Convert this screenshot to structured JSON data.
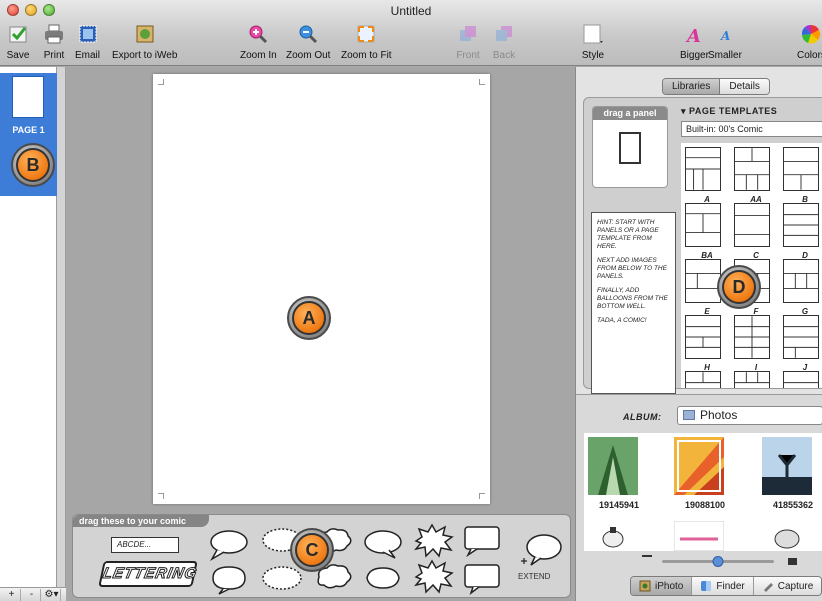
{
  "window": {
    "title": "Untitled"
  },
  "toolbar": {
    "save": "Save",
    "print": "Print",
    "email": "Email",
    "export": "Export to iWeb",
    "zoom_in": "Zoom In",
    "zoom_out": "Zoom Out",
    "zoom_fit": "Zoom to Fit",
    "front": "Front",
    "back": "Back",
    "style": "Style",
    "bigger": "Bigger",
    "smaller": "Smaller",
    "colors": "Colors"
  },
  "pages": {
    "items": [
      {
        "label": "PAGE 1"
      }
    ],
    "footer": {
      "add": "+",
      "remove": "-",
      "action": "⚙▾"
    }
  },
  "callouts": {
    "a": "A",
    "b": "B",
    "c": "C",
    "d": "D"
  },
  "well": {
    "header": "drag these to your comic",
    "text_sample": "ABCDE...",
    "lettering": "LETTERING",
    "extend": "EXTEND"
  },
  "inspector": {
    "tabs": {
      "libraries": "Libraries",
      "details": "Details"
    },
    "drag_panel": "drag a panel",
    "templates_heading": "PAGE TEMPLATES",
    "templates_select": "Built-in: 00's Comic",
    "templates": [
      "A",
      "AA",
      "B",
      "BA",
      "C",
      "D",
      "E",
      "F",
      "G",
      "H",
      "I",
      "J"
    ],
    "hint": {
      "p1": "HINT: Start with PANELS or a PAGE TEMPLATE from here.",
      "p2": "Next add IMAGES from below to the panels.",
      "p3": "Finally, add BALLOONS from the bottom well.",
      "p4": "Tada, a comic!"
    },
    "album_label": "ALBUM:",
    "album_value": "Photos",
    "photos": [
      {
        "caption": "19145941"
      },
      {
        "caption": "19088100"
      },
      {
        "caption": "41855362"
      }
    ],
    "sources": {
      "iphoto": "iPhoto",
      "finder": "Finder",
      "capture": "Capture"
    }
  },
  "colors": {
    "selection": "#3d7dd7",
    "accent_orange": "#ef7a13"
  }
}
